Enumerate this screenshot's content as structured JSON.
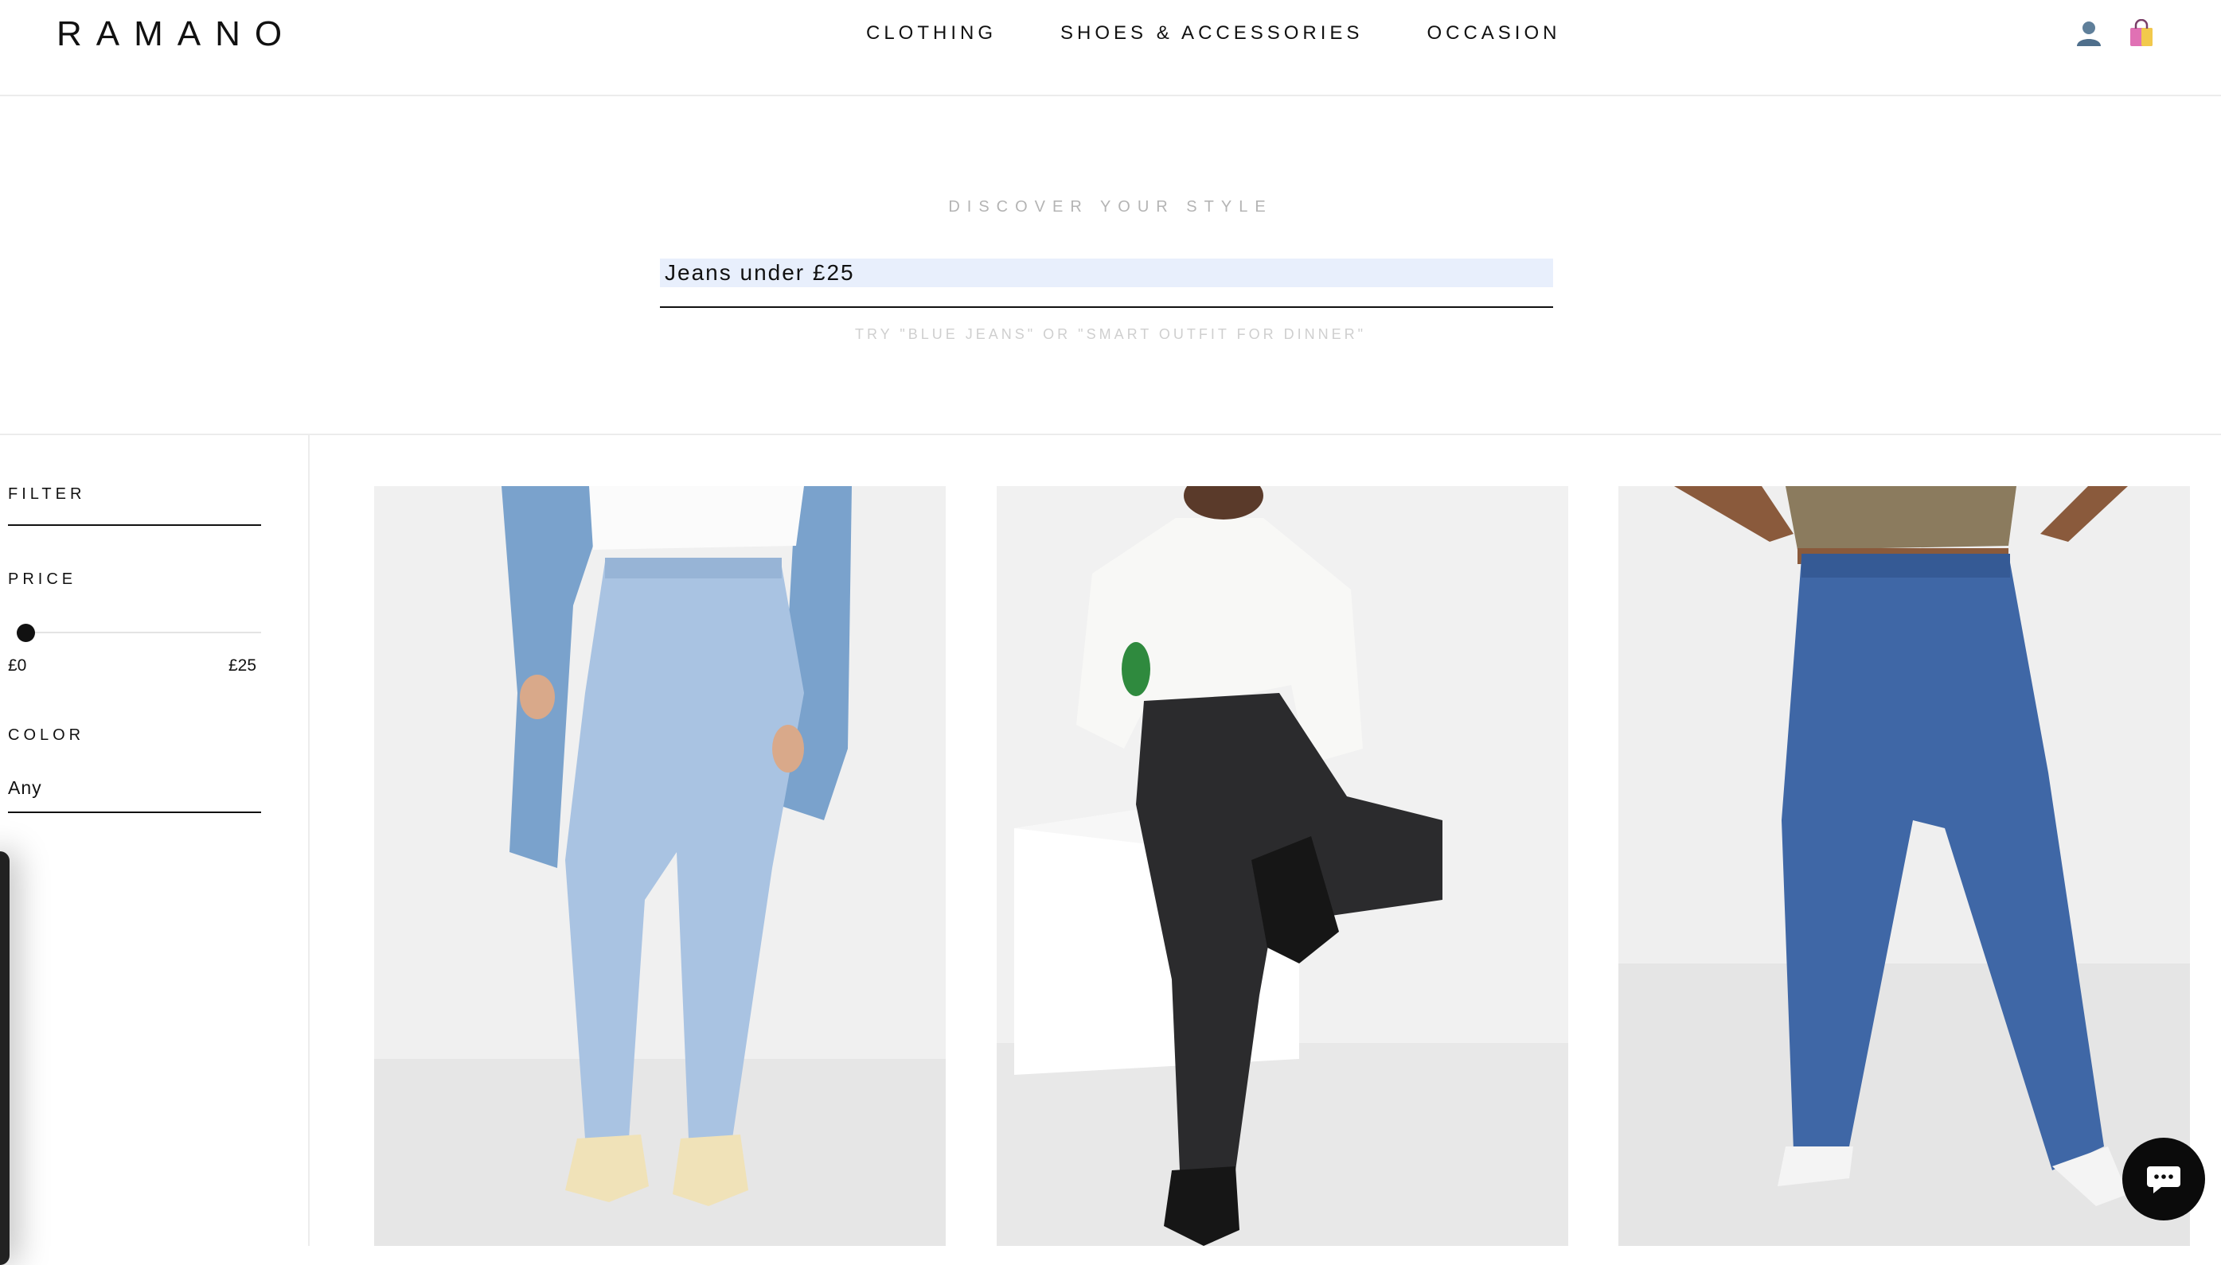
{
  "header": {
    "logo": "RAMANO",
    "nav": [
      "CLOTHING",
      "SHOES & ACCESSORIES",
      "OCCASION"
    ],
    "icons": [
      "user-icon",
      "shopping-bag-icon"
    ]
  },
  "hero": {
    "eyebrow": "DISCOVER YOUR STYLE",
    "search_value": "Jeans under £25",
    "hint": "TRY \"BLUE JEANS\" OR \"SMART OUTFIT FOR DINNER\""
  },
  "sidebar": {
    "filter_label": "FILTER",
    "price_label": "PRICE",
    "price_min": "£0",
    "price_max": "£25",
    "price_slider_value": 0,
    "color_label": "COLOR",
    "color_value": "Any"
  },
  "products": [
    {
      "description_icon": "light-wash-skinny-jeans-image",
      "denim_color": "#a9c3e2"
    },
    {
      "description_icon": "black-mom-jeans-image",
      "denim_color": "#2b2b2d"
    },
    {
      "description_icon": "mid-blue-flare-jeans-image",
      "denim_color": "#3f67a6"
    }
  ],
  "chat": {
    "icon": "chat-icon"
  }
}
